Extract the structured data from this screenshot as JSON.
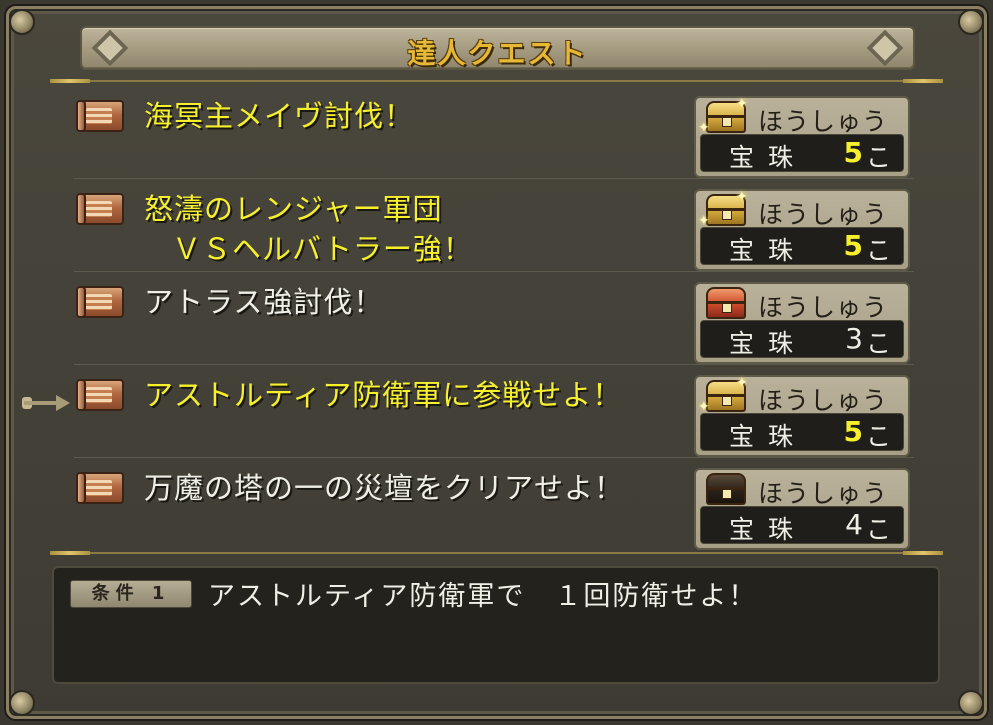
{
  "window": {
    "title": "達人クエスト"
  },
  "quests": [
    {
      "title_line1": "海冥主メイヴ討伐！",
      "title_line2": "",
      "color": "#f6f02c",
      "reward_label": "ほうしゅう",
      "chest": "gold-chest-icon",
      "item": "宝珠",
      "count": "5",
      "unit": "こ",
      "highlight": true
    },
    {
      "title_line1": "怒濤のレンジャー軍団",
      "title_line2": "ＶＳヘルバトラー強！",
      "color": "#f6f02c",
      "reward_label": "ほうしゅう",
      "chest": "gold-chest-icon",
      "item": "宝珠",
      "count": "5",
      "unit": "こ",
      "highlight": true
    },
    {
      "title_line1": "アトラス強討伐！",
      "title_line2": "",
      "color": "#efefe6",
      "reward_label": "ほうしゅう",
      "chest": "red-chest-icon",
      "item": "宝珠",
      "count": "3",
      "unit": "こ",
      "highlight": false
    },
    {
      "title_line1": "アストルティア防衛軍に参戦せよ！",
      "title_line2": "",
      "color": "#f6f02c",
      "reward_label": "ほうしゅう",
      "chest": "gold-chest-icon",
      "item": "宝珠",
      "count": "5",
      "unit": "こ",
      "highlight": true
    },
    {
      "title_line1": "万魔の塔の一の災壇をクリアせよ！",
      "title_line2": "",
      "color": "#efefe6",
      "reward_label": "ほうしゅう",
      "chest": "black-chest-icon",
      "item": "宝珠",
      "count": "4",
      "unit": "こ",
      "highlight": false
    }
  ],
  "condition": {
    "badge": "条件 1",
    "text": "アストルティア防衛軍で　１回防衛せよ！"
  },
  "selected_index": 3
}
